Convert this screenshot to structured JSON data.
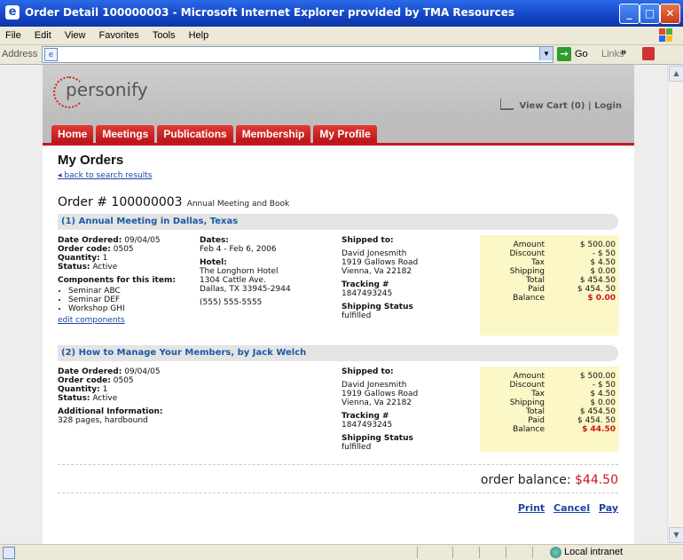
{
  "window": {
    "title": "Order Detail 100000003 - Microsoft Internet Explorer provided by TMA Resources"
  },
  "menu": [
    "File",
    "Edit",
    "View",
    "Favorites",
    "Tools",
    "Help"
  ],
  "address": {
    "label": "Address",
    "value": "",
    "go_label": "Go",
    "links_label": "Links"
  },
  "site": {
    "logo_text": "personify",
    "view_cart": "View Cart (0)",
    "separator": "|",
    "login": "Login",
    "tabs": [
      "Home",
      "Meetings",
      "Publications",
      "Membership",
      "My Profile"
    ]
  },
  "page": {
    "title": "My Orders",
    "back_link": "back to search results",
    "order_prefix": "Order # 100000003",
    "order_description": "Annual Meeting and Book"
  },
  "items": [
    {
      "heading": "(1) Annual Meeting in Dallas, Texas",
      "date_ordered_label": "Date Ordered:",
      "date_ordered": "09/04/05",
      "order_code_label": "Order code:",
      "order_code": "0505",
      "quantity_label": "Quantity:",
      "quantity": "1",
      "status_label": "Status:",
      "status": "Active",
      "components_label": "Components for this item:",
      "components": [
        "Seminar ABC",
        "Seminar DEF",
        "Workshop GHI"
      ],
      "edit_link": "edit components",
      "dates_label": "Dates:",
      "dates": "Feb 4 - Feb 6, 2006",
      "hotel_label": "Hotel:",
      "hotel_name": "The Longhorn Hotel",
      "hotel_street": "1304 Cattle Ave.",
      "hotel_city": "Dallas, TX 33945-2944",
      "phone": "(555) 555-5555",
      "shipped_label": "Shipped to:",
      "ship_name": "David Jonesmith",
      "ship_street": "1919 Gallows Road",
      "ship_city": "Vienna, Va 22182",
      "tracking_label": "Tracking #",
      "tracking": "1847493245",
      "ship_status_label": "Shipping Status",
      "ship_status": "fulfilled",
      "summary": [
        {
          "label": "Amount",
          "value": "$ 500.00"
        },
        {
          "label": "Discount",
          "value": "- $ 50"
        },
        {
          "label": "Tax",
          "value": "$ 4.50"
        },
        {
          "label": "Shipping",
          "value": "$ 0.00"
        },
        {
          "label": "Total",
          "value": "$ 454.50"
        },
        {
          "label": "Paid",
          "value": "$ 454. 50"
        },
        {
          "label": "Balance",
          "value": "$ 0.00"
        }
      ]
    },
    {
      "heading": "(2) How to Manage Your Members, by Jack Welch",
      "date_ordered_label": "Date Ordered:",
      "date_ordered": "09/04/05",
      "order_code_label": "Order code:",
      "order_code": "0505",
      "quantity_label": "Quantity:",
      "quantity": "1",
      "status_label": "Status:",
      "status": "Active",
      "additional_label": "Additional Information:",
      "additional": "328 pages, hardbound",
      "shipped_label": "Shipped to:",
      "ship_name": "David Jonesmith",
      "ship_street": "1919 Gallows Road",
      "ship_city": "Vienna, Va 22182",
      "tracking_label": "Tracking #",
      "tracking": "1847493245",
      "ship_status_label": "Shipping Status",
      "ship_status": "fulfilled",
      "summary": [
        {
          "label": "Amount",
          "value": "$ 500.00"
        },
        {
          "label": "Discount",
          "value": "- $ 50"
        },
        {
          "label": "Tax",
          "value": "$ 4.50"
        },
        {
          "label": "Shipping",
          "value": "$ 0.00"
        },
        {
          "label": "Total",
          "value": "$ 454.50"
        },
        {
          "label": "Paid",
          "value": "$ 454. 50"
        },
        {
          "label": "Balance",
          "value": "$ 44.50"
        }
      ]
    }
  ],
  "order_balance": {
    "label": "order balance:",
    "amount": "$44.50"
  },
  "actions": [
    "Print",
    "Cancel",
    "Pay"
  ],
  "status_bar": {
    "zone": "Local intranet"
  },
  "colors": {
    "brand_red": "#c8161d",
    "link_blue": "#1c44a3",
    "summary_bg": "#fbf7c6",
    "title_bar_blue": "#1545c4"
  }
}
